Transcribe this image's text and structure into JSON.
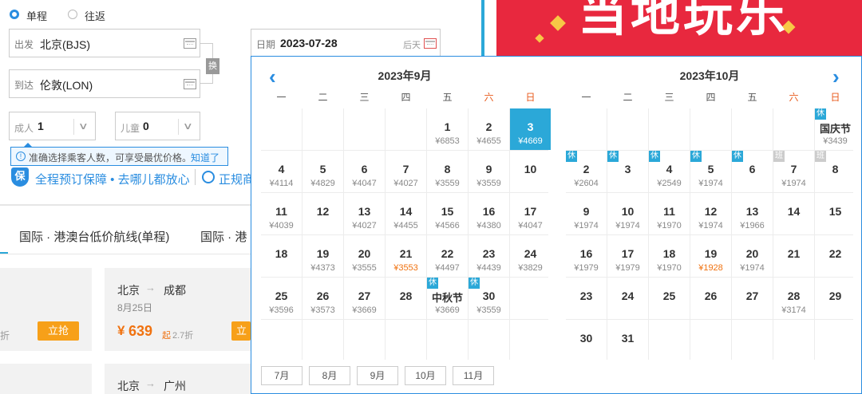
{
  "trip": {
    "oneway": "单程",
    "round": "往返"
  },
  "from": {
    "label": "出发",
    "value": "北京(BJS)"
  },
  "to": {
    "label": "到达",
    "value": "伦敦(LON)"
  },
  "swap": "换",
  "date": {
    "label": "日期",
    "value": "2023-07-28",
    "day": "后天"
  },
  "pax": {
    "adult_label": "成人",
    "adult": "1",
    "child_label": "儿童",
    "child": "0"
  },
  "tip": {
    "text": "准确选择乘客人数，可享受最优价格。",
    "link": "知道了"
  },
  "guarantee": {
    "text": "全程预订保障 • 去哪儿都放心",
    "more": "正规商"
  },
  "tabs": {
    "t1": "国际 · 港澳台低价航线(单程)",
    "t2": "国际 · 港"
  },
  "cards": [
    {
      "route_from": "北京",
      "route_to": "成都",
      "date": "8月25日",
      "price": "639",
      "suffix": "起",
      "disc": "2.7折",
      "btn": "立抢"
    },
    {
      "route_from": "北京",
      "route_to": "广州"
    }
  ],
  "left_frag": "折",
  "card_btn_frag": "立",
  "banner": {
    "text": "当地玩乐"
  },
  "calendar": {
    "weekdays": [
      "一",
      "二",
      "三",
      "四",
      "五",
      "六",
      "日"
    ],
    "sep": {
      "title": "2023年9月",
      "days": [
        {
          "d": "1",
          "p": "¥6853"
        },
        {
          "d": "2",
          "p": "¥4655"
        },
        {
          "d": "3",
          "p": "¥4669",
          "selected": true
        },
        {
          "d": "4",
          "p": "¥4114"
        },
        {
          "d": "5",
          "p": "¥4829"
        },
        {
          "d": "6",
          "p": "¥4047"
        },
        {
          "d": "7",
          "p": "¥4027"
        },
        {
          "d": "8",
          "p": "¥3559"
        },
        {
          "d": "9",
          "p": "¥3559"
        },
        {
          "d": "10",
          "p": ""
        },
        {
          "d": "11",
          "p": "¥4039"
        },
        {
          "d": "12",
          "p": ""
        },
        {
          "d": "13",
          "p": "¥4027"
        },
        {
          "d": "14",
          "p": "¥4455"
        },
        {
          "d": "15",
          "p": "¥4566"
        },
        {
          "d": "16",
          "p": "¥4380"
        },
        {
          "d": "17",
          "p": "¥4047"
        },
        {
          "d": "18",
          "p": ""
        },
        {
          "d": "19",
          "p": "¥4373"
        },
        {
          "d": "20",
          "p": "¥3555"
        },
        {
          "d": "21",
          "p": "¥3553",
          "low": true
        },
        {
          "d": "22",
          "p": "¥4497"
        },
        {
          "d": "23",
          "p": "¥4439"
        },
        {
          "d": "24",
          "p": "¥3829"
        },
        {
          "d": "25",
          "p": "¥3596"
        },
        {
          "d": "26",
          "p": "¥3573"
        },
        {
          "d": "27",
          "p": "¥3669"
        },
        {
          "d": "28",
          "p": ""
        },
        {
          "d": "中秋节",
          "p": "¥3669",
          "tag": "休",
          "hol": true
        },
        {
          "d": "30",
          "p": "¥3559",
          "tag": "休"
        }
      ]
    },
    "oct": {
      "title": "2023年10月",
      "days": [
        {
          "d": "国庆节",
          "p": "¥3439",
          "tag": "休",
          "hol": true
        },
        {
          "d": "2",
          "p": "¥2604",
          "tag": "休"
        },
        {
          "d": "3",
          "p": "",
          "tag": "休"
        },
        {
          "d": "4",
          "p": "¥2549",
          "tag": "休"
        },
        {
          "d": "5",
          "p": "¥1974",
          "tag": "休"
        },
        {
          "d": "6",
          "p": "",
          "tag": "休"
        },
        {
          "d": "7",
          "p": "¥1974",
          "tag": "班",
          "work": true
        },
        {
          "d": "8",
          "p": "",
          "tag": "班",
          "work": true
        },
        {
          "d": "9",
          "p": "¥1974"
        },
        {
          "d": "10",
          "p": "¥1974"
        },
        {
          "d": "11",
          "p": "¥1970"
        },
        {
          "d": "12",
          "p": "¥1974"
        },
        {
          "d": "13",
          "p": "¥1966"
        },
        {
          "d": "14",
          "p": ""
        },
        {
          "d": "15",
          "p": ""
        },
        {
          "d": "16",
          "p": "¥1979"
        },
        {
          "d": "17",
          "p": "¥1979"
        },
        {
          "d": "18",
          "p": "¥1970"
        },
        {
          "d": "19",
          "p": "¥1928",
          "low": true
        },
        {
          "d": "20",
          "p": "¥1974"
        },
        {
          "d": "21",
          "p": ""
        },
        {
          "d": "22",
          "p": ""
        },
        {
          "d": "23",
          "p": ""
        },
        {
          "d": "24",
          "p": ""
        },
        {
          "d": "25",
          "p": ""
        },
        {
          "d": "26",
          "p": ""
        },
        {
          "d": "27",
          "p": ""
        },
        {
          "d": "28",
          "p": "¥3174"
        },
        {
          "d": "29",
          "p": ""
        },
        {
          "d": "30",
          "p": ""
        },
        {
          "d": "31",
          "p": ""
        }
      ]
    },
    "months": [
      "7月",
      "8月",
      "9月",
      "10月",
      "11月"
    ],
    "colors": {
      "accent": "#2a8de0",
      "selected": "#2ba8d8",
      "weekend": "#e8591a",
      "low": "#f07210"
    }
  }
}
